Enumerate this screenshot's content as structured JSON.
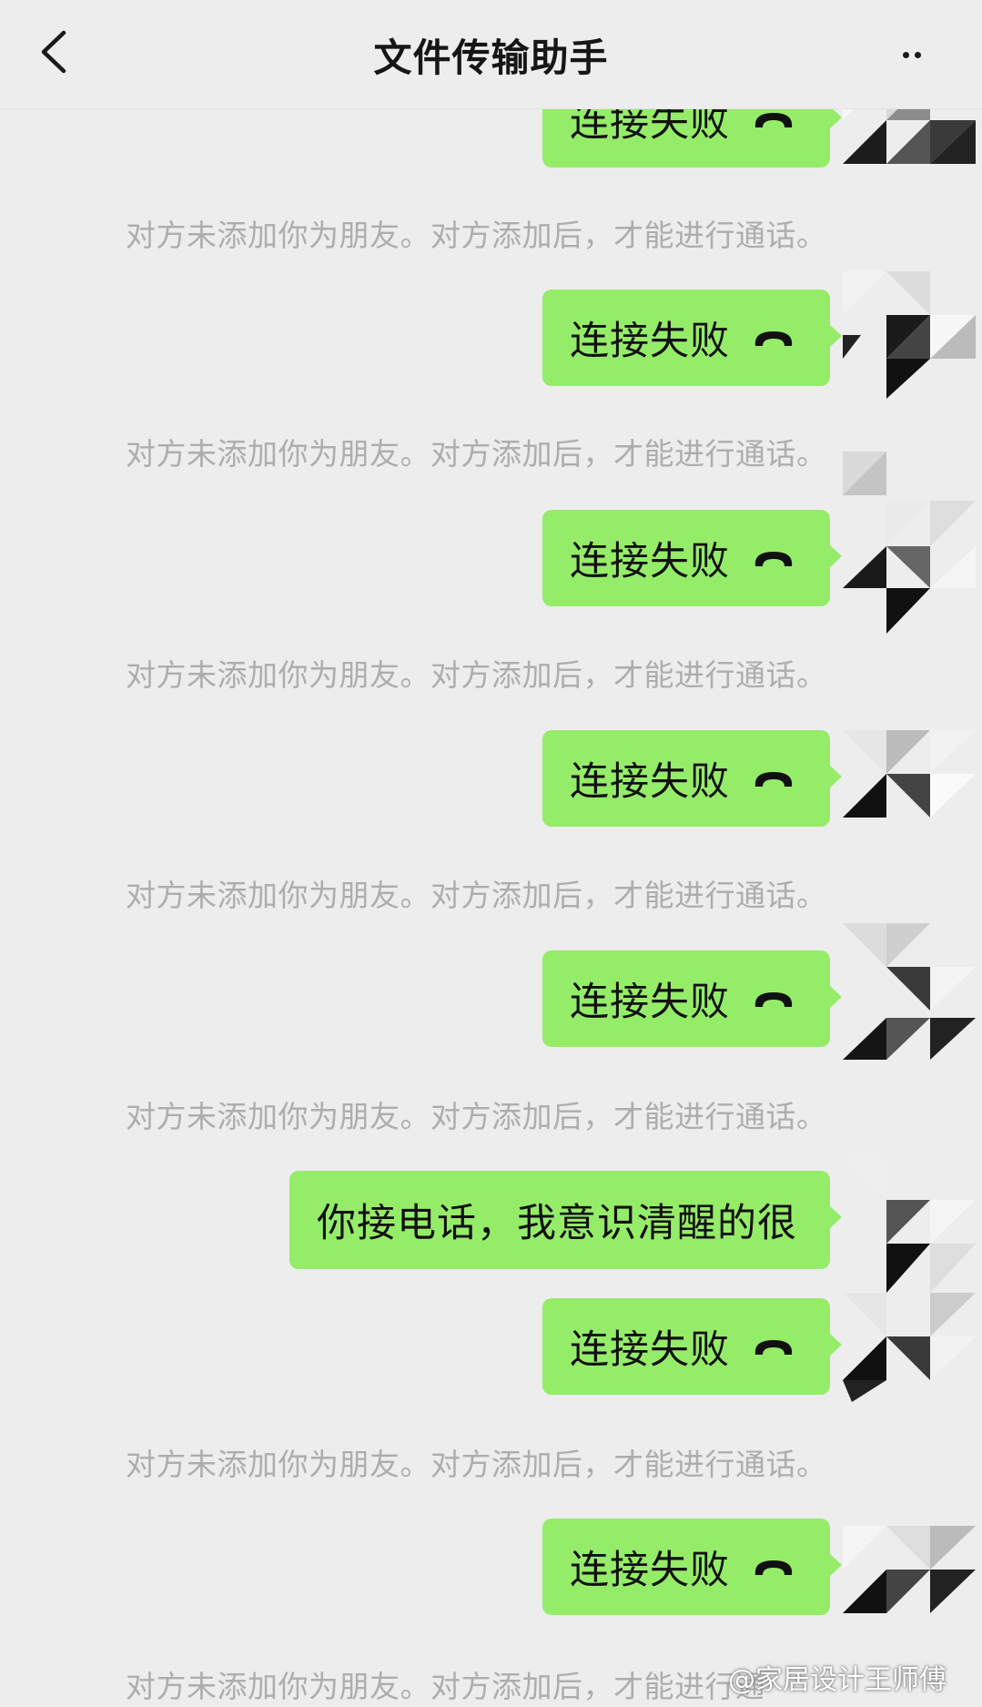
{
  "header": {
    "title": "文件传输助手",
    "back_icon": "chevron-left-icon",
    "more_icon": "more-dots-icon"
  },
  "messages": {
    "call_failed_label": "连接失败",
    "voice_text": "你接电话，我意识清醒的很",
    "system_notice": "对方未添加你为朋友。对方添加后，才能进行通话。"
  },
  "watermark": "@家居设计王师傅",
  "colors": {
    "background": "#ededed",
    "bubble_green": "#95ec69",
    "system_text": "#adadad",
    "title_text": "#161616"
  }
}
